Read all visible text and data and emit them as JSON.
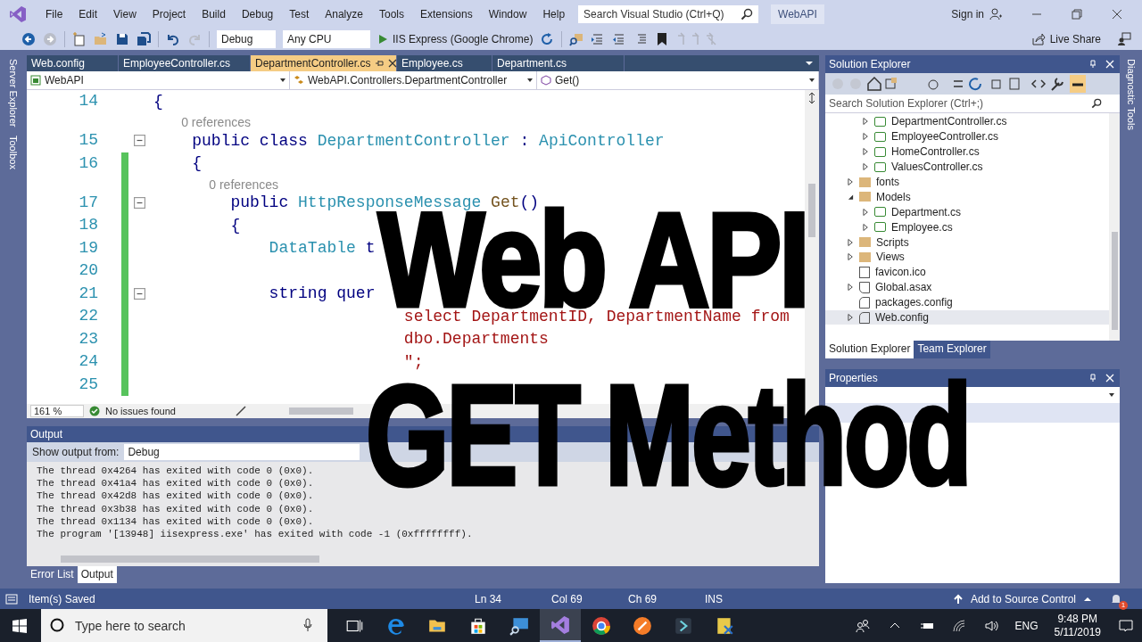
{
  "menu": {
    "items": [
      "File",
      "Edit",
      "View",
      "Project",
      "Build",
      "Debug",
      "Test",
      "Analyze",
      "Tools",
      "Extensions",
      "Window",
      "Help"
    ],
    "search_placeholder": "Search Visual Studio (Ctrl+Q)",
    "solution": "WebAPI",
    "sign_in": "Sign in"
  },
  "toolbar": {
    "configuration": "Debug",
    "platform": "Any CPU",
    "run_target": "IIS Express (Google Chrome)",
    "live_share": "Live Share"
  },
  "left_strip": [
    "Server Explorer",
    "Toolbox"
  ],
  "editor": {
    "tabs": [
      {
        "label": "Web.config",
        "selected": false
      },
      {
        "label": "EmployeeController.cs",
        "selected": false
      },
      {
        "label": "DepartmentController.cs",
        "selected": true
      },
      {
        "label": "Employee.cs",
        "selected": false
      },
      {
        "label": "Department.cs",
        "selected": false
      }
    ],
    "nav": {
      "project": "WebAPI",
      "type": "WebAPI.Controllers.DepartmentController",
      "member": "Get()"
    },
    "lines": [
      {
        "number": "14",
        "changed": false,
        "fold": false,
        "tokens": [
          {
            "text": "{",
            "kind": "plain"
          }
        ]
      },
      {
        "number": "15",
        "changed": false,
        "fold": true,
        "codelens": "0 references",
        "tokens": [
          {
            "text": "    public class ",
            "kind": "kw"
          },
          {
            "text": "DepartmentController",
            "kind": "type"
          },
          {
            "text": " : ",
            "kind": "plain"
          },
          {
            "text": "ApiController",
            "kind": "type"
          }
        ]
      },
      {
        "number": "16",
        "changed": true,
        "fold": false,
        "tokens": [
          {
            "text": "    {",
            "kind": "plain"
          }
        ]
      },
      {
        "number": "17",
        "changed": true,
        "fold": true,
        "codelens": "0 references",
        "tokens": [
          {
            "text": "        public ",
            "kind": "kw"
          },
          {
            "text": "HttpResponseMessage ",
            "kind": "type"
          },
          {
            "text": "Get",
            "kind": "method"
          },
          {
            "text": "()",
            "kind": "plain"
          }
        ]
      },
      {
        "number": "18",
        "changed": true,
        "fold": false,
        "tokens": [
          {
            "text": "        {",
            "kind": "plain"
          }
        ]
      },
      {
        "number": "19",
        "changed": true,
        "fold": false,
        "tokens": [
          {
            "text": "            DataTable",
            "kind": "type"
          },
          {
            "text": " t",
            "kind": "plain"
          }
        ]
      },
      {
        "number": "20",
        "changed": true,
        "fold": false
      },
      {
        "number": "21",
        "changed": true,
        "fold": true,
        "tokens": [
          {
            "text": "            string",
            "kind": "kw"
          },
          {
            "text": " quer",
            "kind": "plain"
          }
        ]
      },
      {
        "number": "22",
        "changed": true,
        "fold": false,
        "tokens": [
          {
            "text": "                          select DepartmentID, DepartmentName from",
            "kind": "str"
          }
        ]
      },
      {
        "number": "23",
        "changed": true,
        "fold": false,
        "tokens": [
          {
            "text": "                          dbo.Departments",
            "kind": "str"
          }
        ]
      },
      {
        "number": "24",
        "changed": true,
        "fold": false,
        "tokens": [
          {
            "text": "                          \";",
            "kind": "str"
          }
        ]
      },
      {
        "number": "25",
        "changed": true,
        "fold": false
      }
    ],
    "zoom": "161 %",
    "issues": "No issues found"
  },
  "output": {
    "title": "Output",
    "show_from_label": "Show output from:",
    "source": "Debug",
    "lines": [
      "The thread 0x4264 has exited with code 0 (0x0).",
      "The thread 0x41a4 has exited with code 0 (0x0).",
      "The thread 0x42d8 has exited with code 0 (0x0).",
      "The thread 0x3b38 has exited with code 0 (0x0).",
      "The thread 0x1134 has exited with code 0 (0x0).",
      "The program '[13948] iisexpress.exe' has exited with code -1 (0xffffffff)."
    ],
    "tabs": [
      {
        "label": "Error List",
        "selected": false
      },
      {
        "label": "Output",
        "selected": true
      }
    ]
  },
  "solution_explorer": {
    "title": "Solution Explorer",
    "search_placeholder": "Search Solution Explorer (Ctrl+;)",
    "scrolled_folder_children": [
      {
        "label": "DepartmentController.cs",
        "kind": "cs",
        "expanded": false,
        "selected": false
      },
      {
        "label": "EmployeeController.cs",
        "kind": "cs",
        "expanded": false,
        "selected": false
      },
      {
        "label": "HomeController.cs",
        "kind": "cs",
        "expanded": false,
        "selected": false
      },
      {
        "label": "ValuesController.cs",
        "kind": "cs",
        "expanded": false,
        "selected": false
      }
    ],
    "items": [
      {
        "label": "fonts",
        "kind": "folder",
        "expanded": false,
        "selected": false
      },
      {
        "label": "Models",
        "kind": "folder",
        "expanded": true,
        "selected": false,
        "children": [
          {
            "label": "Department.cs",
            "kind": "cs",
            "expanded": false,
            "selected": false
          },
          {
            "label": "Employee.cs",
            "kind": "cs",
            "expanded": false,
            "selected": false
          }
        ]
      },
      {
        "label": "Scripts",
        "kind": "folder",
        "expanded": false,
        "selected": false
      },
      {
        "label": "Views",
        "kind": "folder",
        "expanded": false,
        "selected": false
      },
      {
        "label": "favicon.ico",
        "kind": "file",
        "selected": false
      },
      {
        "label": "Global.asax",
        "kind": "asax",
        "expanded": false,
        "selected": false
      },
      {
        "label": "packages.config",
        "kind": "config",
        "selected": false
      },
      {
        "label": "Web.config",
        "kind": "config",
        "expanded": false,
        "selected": true
      }
    ],
    "tabs": [
      {
        "label": "Solution Explorer",
        "selected": true
      },
      {
        "label": "Team Explorer",
        "selected": false
      }
    ]
  },
  "properties": {
    "title": "Properties"
  },
  "right_strip": [
    "Diagnostic Tools"
  ],
  "status_bar": {
    "message": "Item(s) Saved",
    "line": "Ln 34",
    "column": "Col 69",
    "char": "Ch 69",
    "mode": "INS",
    "source_control": "Add to Source Control",
    "notifications": "1"
  },
  "taskbar": {
    "search_placeholder": "Type here to search",
    "language": "ENG",
    "time": "9:48 PM",
    "date": "5/11/2019"
  },
  "overlay": [
    "Web API",
    "GET Method"
  ]
}
